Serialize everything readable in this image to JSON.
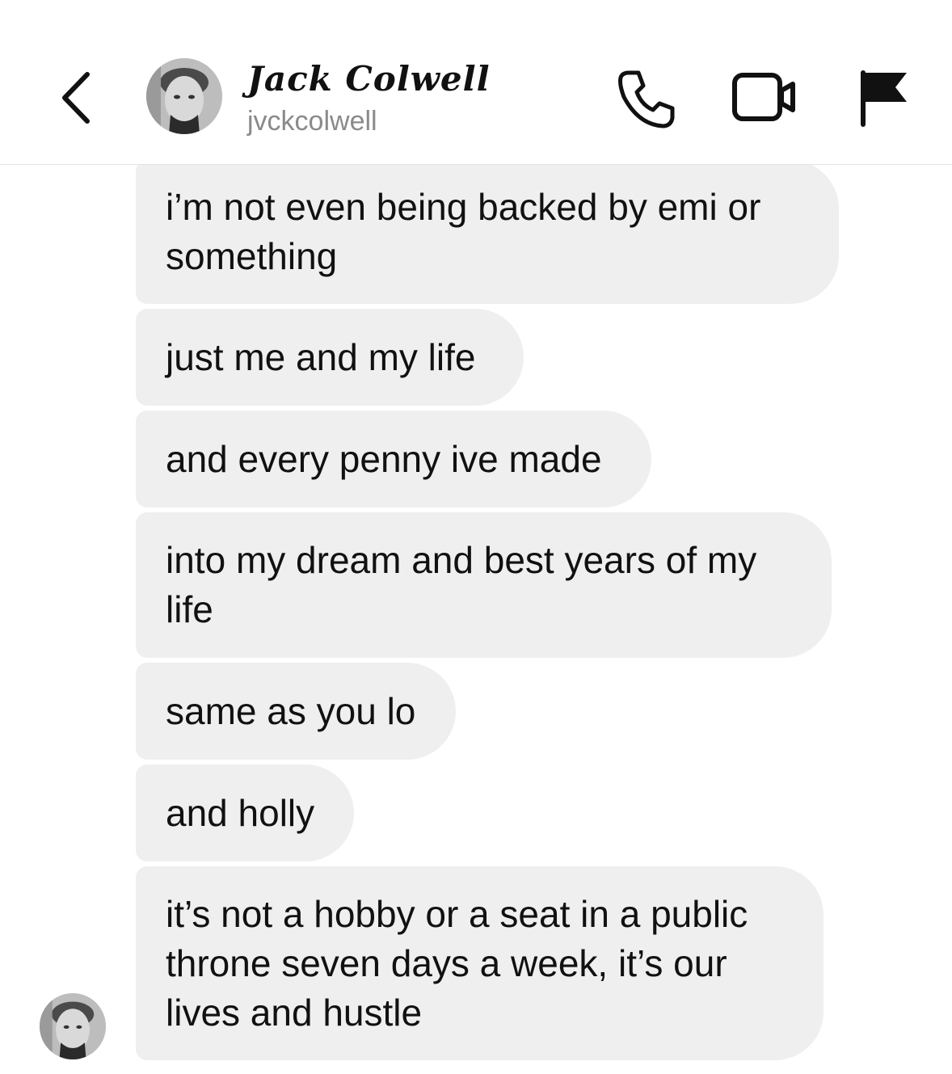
{
  "header": {
    "display_name": "Jack Colwell",
    "username": "jvckcolwell",
    "icons": {
      "back": "chevron-left-icon",
      "call": "phone-icon",
      "video": "video-camera-icon",
      "report": "flag-icon"
    }
  },
  "messages": [
    {
      "text": "i’m not even being backed by emi or something"
    },
    {
      "text": "just me and my life"
    },
    {
      "text": "and every penny ive made"
    },
    {
      "text": "into my dream and best years of my life"
    },
    {
      "text": "same as you lo"
    },
    {
      "text": "and holly"
    },
    {
      "text": "it’s not a hobby or a seat in a public throne seven days a week, it’s our lives and hustle"
    }
  ],
  "colors": {
    "bubble": "#efefef",
    "text": "#111111",
    "username": "#8a8a8a",
    "divider": "#e3e3e3"
  }
}
